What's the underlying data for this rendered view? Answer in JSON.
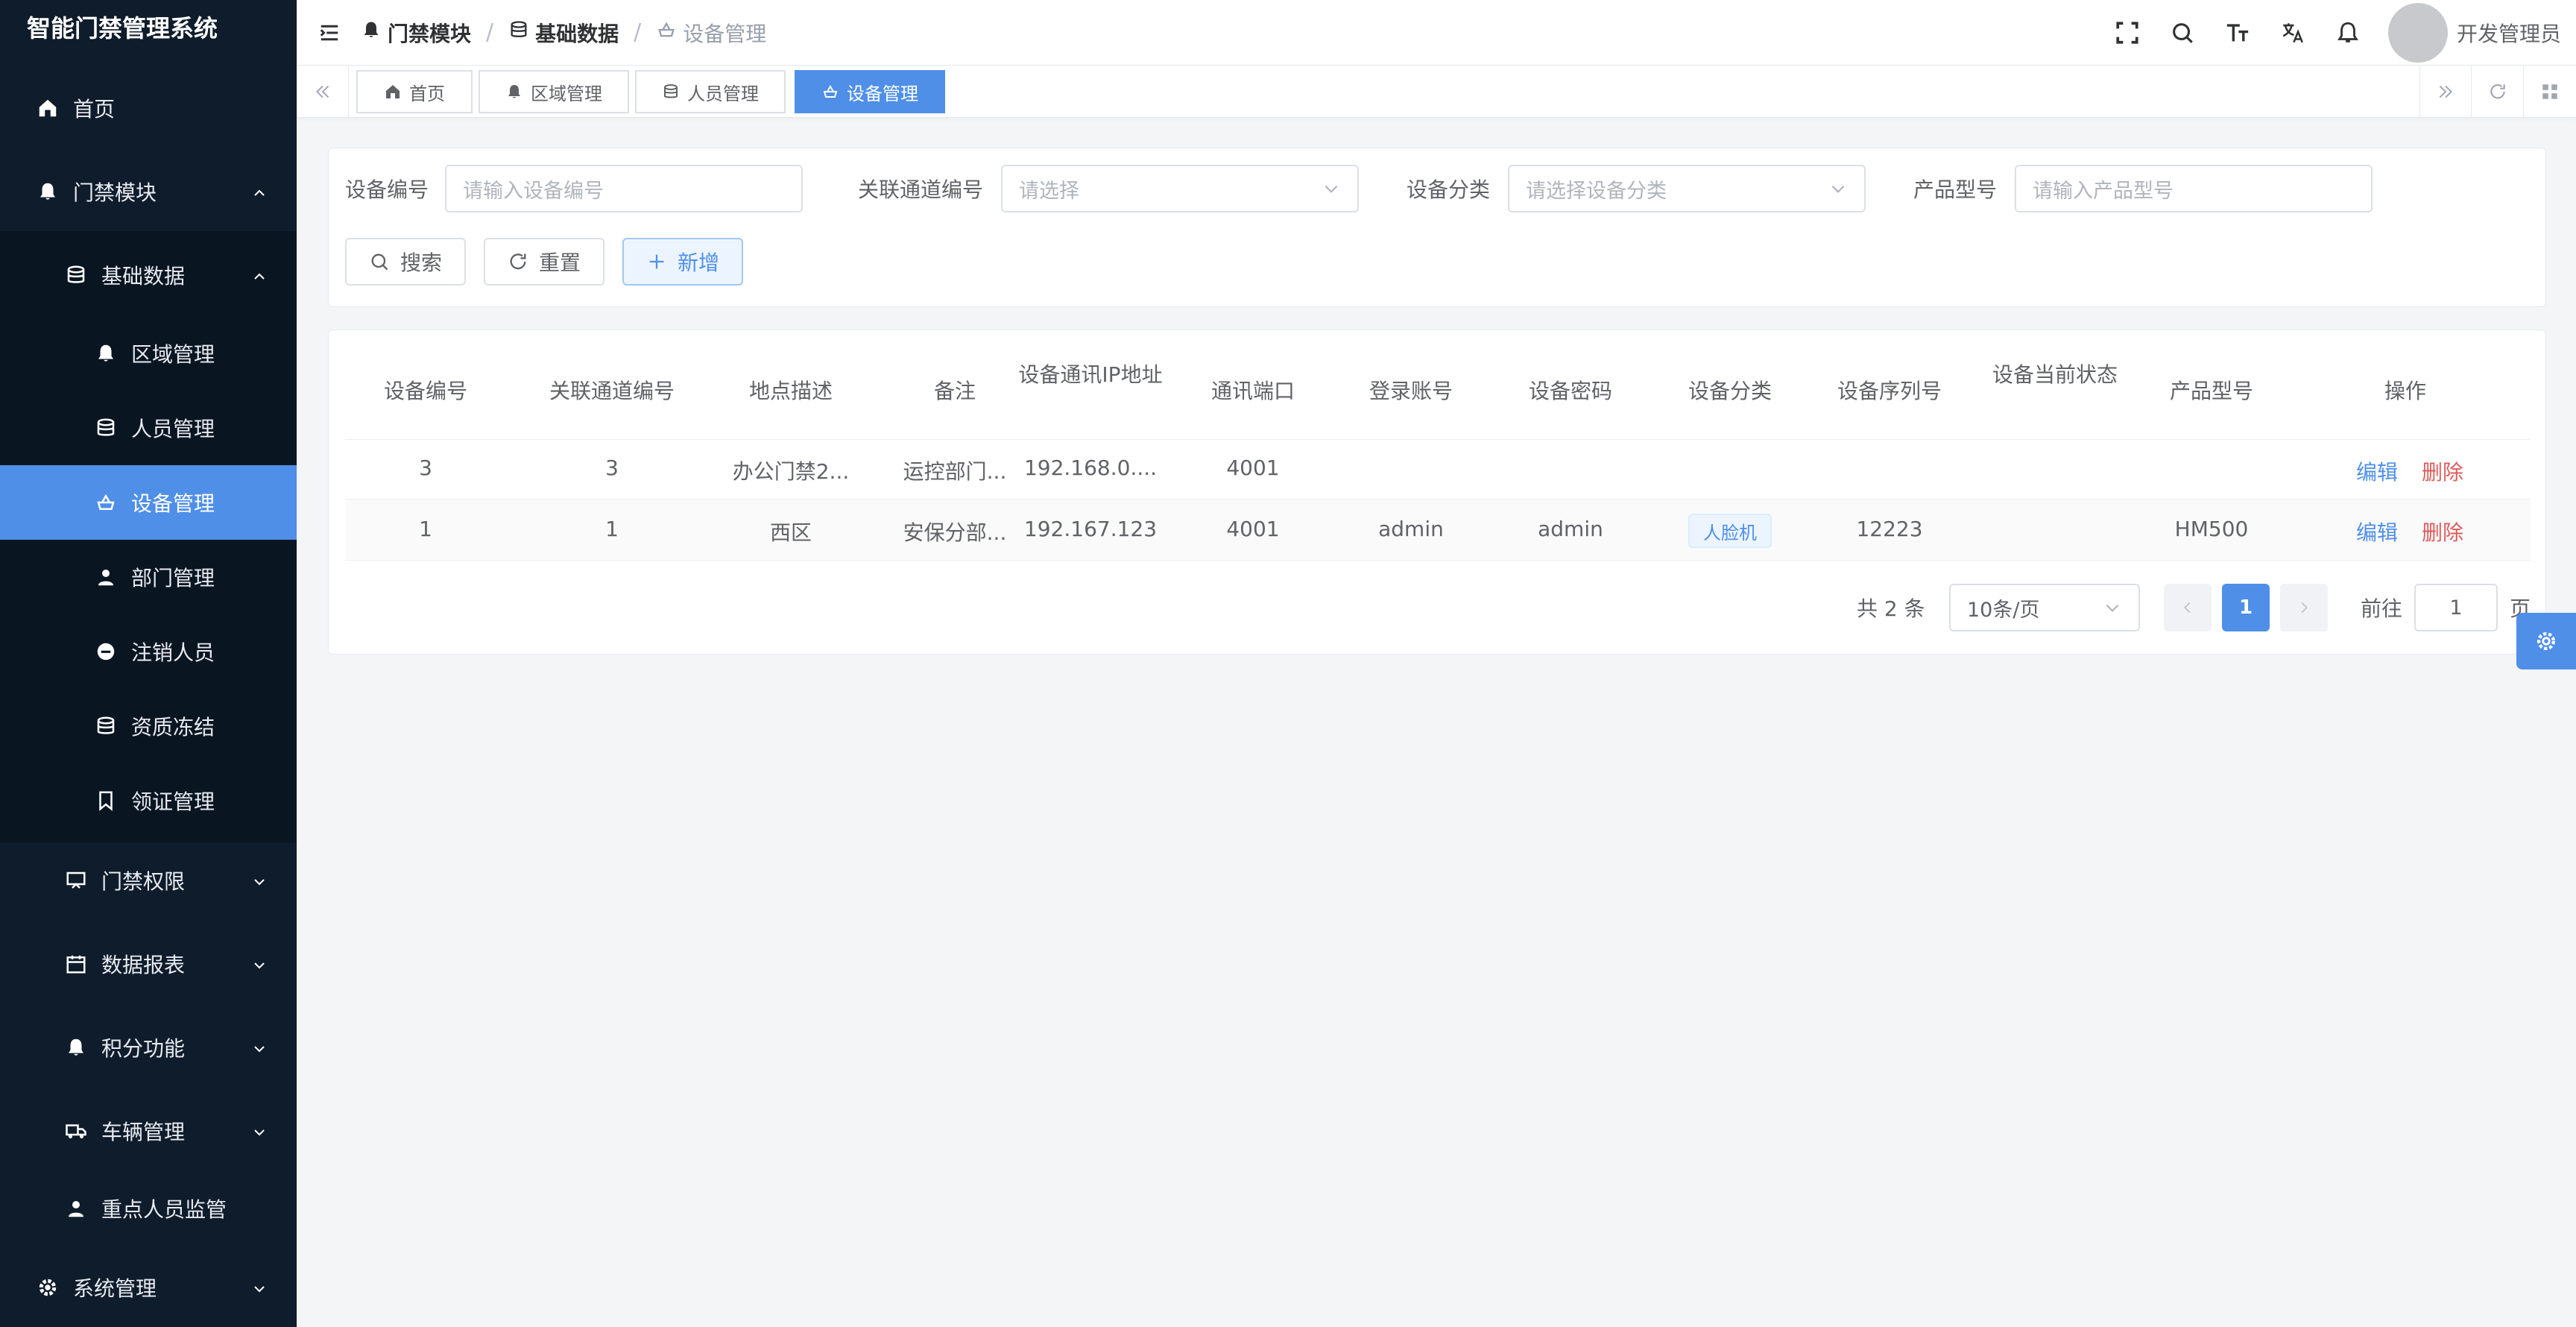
{
  "app": {
    "title": "智能门禁管理系统"
  },
  "sidebar": {
    "items": [
      {
        "label": "首页",
        "icon": "home-icon"
      },
      {
        "label": "门禁模块",
        "icon": "bell-icon"
      },
      {
        "label": "基础数据",
        "icon": "database-icon"
      },
      {
        "label": "区域管理",
        "icon": "bell-icon"
      },
      {
        "label": "人员管理",
        "icon": "database-icon"
      },
      {
        "label": "设备管理",
        "icon": "device-icon"
      },
      {
        "label": "部门管理",
        "icon": "user-icon"
      },
      {
        "label": "注销人员",
        "icon": "minus-circle-icon"
      },
      {
        "label": "资质冻结",
        "icon": "database-icon"
      },
      {
        "label": "领证管理",
        "icon": "bookmark-icon"
      },
      {
        "label": "门禁权限",
        "icon": "monitor-icon"
      },
      {
        "label": "数据报表",
        "icon": "calendar-icon"
      },
      {
        "label": "积分功能",
        "icon": "bell-icon"
      },
      {
        "label": "车辆管理",
        "icon": "truck-icon"
      },
      {
        "label": "重点人员监管",
        "icon": "user-icon"
      },
      {
        "label": "系统管理",
        "icon": "gear-icon"
      }
    ]
  },
  "header": {
    "breadcrumb": [
      "门禁模块",
      "基础数据",
      "设备管理"
    ],
    "username": "开发管理员"
  },
  "tabs": [
    "首页",
    "区域管理",
    "人员管理",
    "设备管理"
  ],
  "search": {
    "fields": [
      {
        "label": "设备编号",
        "placeholder": "请输入设备编号"
      },
      {
        "label": "关联通道编号",
        "placeholder": "请选择"
      },
      {
        "label": "设备分类",
        "placeholder": "请选择设备分类"
      },
      {
        "label": "产品型号",
        "placeholder": "请输入产品型号"
      }
    ],
    "buttons": {
      "search": "搜索",
      "reset": "重置",
      "add": "新增"
    }
  },
  "table": {
    "headers": [
      "设备编号",
      "关联通道编号",
      "地点描述",
      "备注",
      "设备通讯IP地址",
      "通讯端口",
      "登录账号",
      "设备密码",
      "设备分类",
      "设备序列号",
      "设备当前状态",
      "产品型号",
      "操作"
    ],
    "rows": [
      {
        "device_no": "3",
        "channel": "3",
        "location": "办公门禁2...",
        "remark": "运控部门...",
        "ip": "192.168.0....",
        "port": "4001",
        "account": "",
        "password": "",
        "category": "",
        "serial": "",
        "status": "",
        "model": ""
      },
      {
        "device_no": "1",
        "channel": "1",
        "location": "西区",
        "remark": "安保分部...",
        "ip": "192.167.123",
        "port": "4001",
        "account": "admin",
        "password": "admin",
        "category": "人脸机",
        "serial": "12223",
        "status": "",
        "model": "HM500"
      }
    ],
    "actions": {
      "edit": "编辑",
      "delete": "删除"
    }
  },
  "pagination": {
    "total_text": "共 2 条",
    "page_size": "10条/页",
    "current_page": "1",
    "goto_label": "前往",
    "goto_value": "1",
    "page_suffix": "页"
  },
  "colors": {
    "sidebar_bg": "#0f1c2b",
    "accent": "#4f8fe8",
    "danger": "#e05b5b"
  }
}
